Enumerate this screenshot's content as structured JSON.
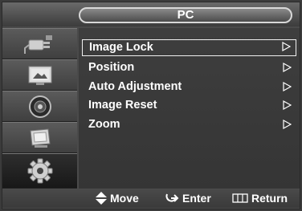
{
  "title": "PC",
  "sidebar": {
    "icons": [
      {
        "name": "plug-icon",
        "active": false
      },
      {
        "name": "picture-icon",
        "active": false
      },
      {
        "name": "speaker-icon",
        "active": false
      },
      {
        "name": "screen-icon",
        "active": false
      },
      {
        "name": "gear-icon",
        "active": true
      }
    ]
  },
  "menu": {
    "items": [
      {
        "label": "Image Lock",
        "selected": true
      },
      {
        "label": "Position",
        "selected": false
      },
      {
        "label": "Auto Adjustment",
        "selected": false
      },
      {
        "label": "Image Reset",
        "selected": false
      },
      {
        "label": "Zoom",
        "selected": false
      }
    ]
  },
  "footer": {
    "move": "Move",
    "enter": "Enter",
    "return": "Return"
  }
}
